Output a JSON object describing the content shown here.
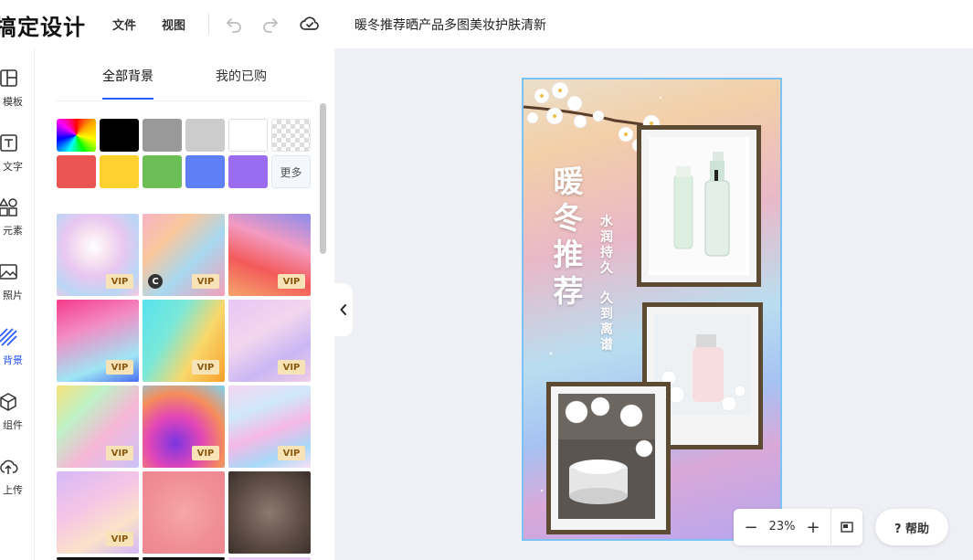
{
  "app": {
    "logo": "搞定设计"
  },
  "toolbar": {
    "file_label": "文件",
    "view_label": "视图",
    "document_title": "暖冬推荐晒产品多图美妆护肤清新"
  },
  "sidebar": {
    "items": [
      {
        "label": "模板",
        "visible": "模板"
      },
      {
        "label": "文字",
        "visible": "文字"
      },
      {
        "label": "元素",
        "visible": "元素"
      },
      {
        "label": "照片",
        "visible": "照片"
      },
      {
        "label": "背景",
        "visible": "背景"
      },
      {
        "label": "组件",
        "visible": "组件"
      },
      {
        "label": "上传",
        "visible": "上传"
      }
    ],
    "active": "背景"
  },
  "panel": {
    "tabs": [
      {
        "label": "全部背景",
        "active": true
      },
      {
        "label": "我的已购",
        "active": false
      }
    ],
    "colors": [
      "#ff0000-rainbow",
      "#000000",
      "#999999",
      "#cccccc",
      "#ffffff",
      "transparent",
      "#e85552",
      "#fdd130",
      "#6cbf56",
      "#5f7ff6",
      "#9a6cf0"
    ],
    "more_label": "更多",
    "vip_label": "VIP",
    "copyright_badge": "C"
  },
  "poster": {
    "headline": "暖\n冬\n推\n荐",
    "sub1": "水\n润\n持\n久",
    "sub2": "久\n到\n离\n谱"
  },
  "zoom": {
    "minus": "−",
    "value": "23%",
    "plus": "+"
  },
  "help": {
    "label": "? 帮助"
  },
  "colors": {
    "accent": "#2e5bff",
    "workspace": "#eef0f6",
    "canvas_border": "#7cc3f5",
    "vip_bg": "#f7e3b6"
  }
}
